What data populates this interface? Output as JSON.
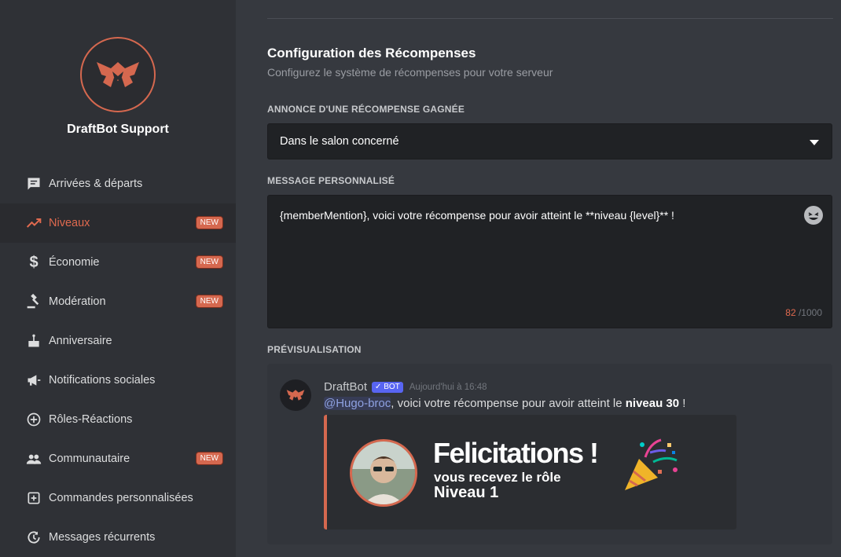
{
  "sidebar": {
    "server_name": "DraftBot Support",
    "items": [
      {
        "label": "Arrivées & départs",
        "icon": "chat-icon",
        "badge": ""
      },
      {
        "label": "Niveaux",
        "icon": "trending-up-icon",
        "badge": "NEW",
        "active": true
      },
      {
        "label": "Économie",
        "icon": "dollar-icon",
        "badge": "NEW"
      },
      {
        "label": "Modération",
        "icon": "gavel-icon",
        "badge": "NEW"
      },
      {
        "label": "Anniversaire",
        "icon": "cake-icon",
        "badge": ""
      },
      {
        "label": "Notifications sociales",
        "icon": "megaphone-icon",
        "badge": ""
      },
      {
        "label": "Rôles-Réactions",
        "icon": "plus-circle-icon",
        "badge": ""
      },
      {
        "label": "Communautaire",
        "icon": "people-icon",
        "badge": "NEW"
      },
      {
        "label": "Commandes personnalisées",
        "icon": "add-box-icon",
        "badge": ""
      },
      {
        "label": "Messages récurrents",
        "icon": "history-icon",
        "badge": ""
      }
    ]
  },
  "main": {
    "title": "Configuration des Récompenses",
    "subtitle": "Configurez le système de récompenses pour votre serveur",
    "announce_label": "ANNONCE D'UNE RÉCOMPENSE GAGNÉE",
    "announce_value": "Dans le salon concerné",
    "message_label": "MESSAGE PERSONNALISÉ",
    "message_value": "{memberMention}, voici votre récompense pour avoir atteint le **niveau {level}** !",
    "char_count": "82",
    "char_max": "/1000",
    "preview_label": "PRÉVISUALISATION"
  },
  "preview": {
    "author": "DraftBot",
    "bot_tag": "✓ BOT",
    "timestamp": "Aujourd'hui à 16:48",
    "mention": "@Hugo-broc",
    "text_before": ", voici votre récompense pour avoir atteint le ",
    "bold": "niveau 30",
    "text_after": " !",
    "card_title": "Felicitations !",
    "card_line": "vous recevez le rôle",
    "card_level": "Niveau 1"
  },
  "colors": {
    "accent": "#d5684f",
    "sidebar_bg": "#2f3136",
    "main_bg": "#36393f",
    "input_bg": "#202225"
  }
}
